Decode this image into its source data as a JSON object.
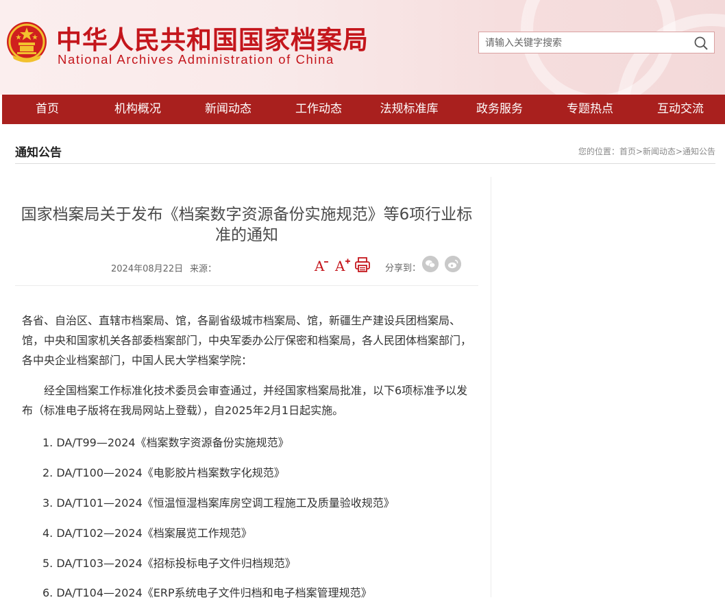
{
  "header": {
    "title_cn": "中华人民共和国国家档案局",
    "title_en": "National Archives Administration of China",
    "search_placeholder": "请输入关键字搜索",
    "brand_color": "#c4161c"
  },
  "nav": {
    "items": [
      "首页",
      "机构概况",
      "新闻动态",
      "工作动态",
      "法规标准库",
      "政务服务",
      "专题热点",
      "互动交流"
    ],
    "color": "#a9201e"
  },
  "breadcrumb_row": {
    "section_title": "通知公告",
    "position_label": "您的位置：",
    "crumbs": [
      "首页",
      "新闻动态",
      "通知公告"
    ],
    "separator": ">"
  },
  "article": {
    "title": "国家档案局关于发布《档案数字资源备份实施规范》等6项行业标准的通知",
    "date": "2024年08月22日",
    "source_label": "来源：",
    "share_label": "分享到：",
    "paragraphs": [
      "各省、自治区、直辖市档案局、馆，各副省级城市档案局、馆，新疆生产建设兵团档案局、馆，中央和国家机关各部委档案部门，中央军委办公厅保密和档案局，各人民团体档案部门，各中央企业档案部门，中国人民大学档案学院：",
      "经全国档案工作标准化技术委员会审查通过，并经国家档案局批准，以下6项标准予以发布（标准电子版将在我局网站上登载），自2025年2月1日起实施。"
    ],
    "standards": [
      "1.  DA/T99—2024《档案数字资源备份实施规范》",
      "2.  DA/T100—2024《电影胶片档案数字化规范》",
      "3.  DA/T101—2024《恒温恒湿档案库房空调工程施工及质量验收规范》",
      "4.  DA/T102—2024《档案展览工作规范》",
      "5.  DA/T103—2024《招标投标电子文件归档规范》",
      "6.  DA/T104—2024《ERP系统电子文件归档和电子档案管理规范》"
    ]
  }
}
